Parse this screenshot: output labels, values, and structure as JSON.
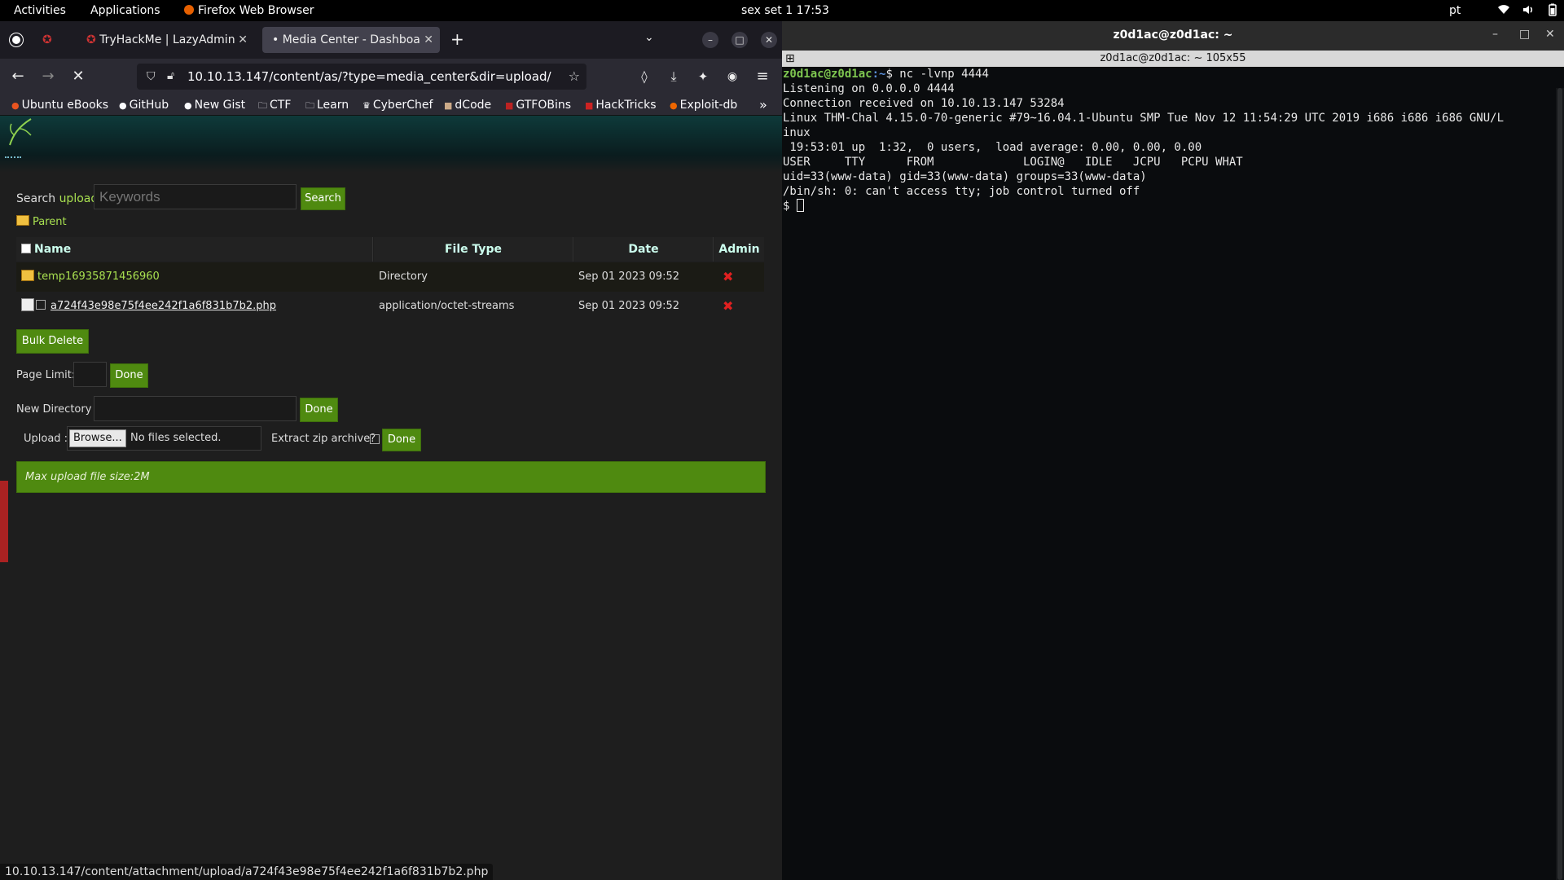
{
  "topbar": {
    "activities": "Activities",
    "applications": "Applications",
    "app_name": "Firefox Web Browser",
    "clock": "sex set 1  17:53",
    "lang": "pt"
  },
  "firefox": {
    "tabs": [
      {
        "label": "TryHackMe | LazyAdmin"
      },
      {
        "label": "Media Center - Dashboard"
      }
    ],
    "new_tab": "+",
    "url": "10.10.13.147/content/as/?type=media_center&dir=upload/",
    "bookmarks": [
      {
        "label": "Ubuntu eBooks"
      },
      {
        "label": "GitHub"
      },
      {
        "label": "New Gist"
      },
      {
        "label": "CTF"
      },
      {
        "label": "Learn"
      },
      {
        "label": "CyberChef"
      },
      {
        "label": "dCode"
      },
      {
        "label": "GTFOBins"
      },
      {
        "label": "HackTricks"
      },
      {
        "label": "Exploit-db"
      }
    ],
    "status_url": "10.10.13.147/content/attachment/upload/a724f43e98e75f4ee242f1a6f831b7b2.php"
  },
  "page": {
    "search_label_prefix": "Search ",
    "search_dir": "upload/",
    "search_placeholder": "Keywords",
    "search_button": "Search",
    "parent_link": "Parent",
    "columns": [
      "Name",
      "File Type",
      "Date",
      "Admin"
    ],
    "rows": [
      {
        "name": "temp16935871456960",
        "type": "Directory",
        "date": "Sep 01 2023 09:52"
      },
      {
        "name": "a724f43e98e75f4ee242f1a6f831b7b2.php",
        "type": "application/octet-streams",
        "date": "Sep 01 2023 09:52"
      }
    ],
    "bulk_delete": "Bulk Delete",
    "page_limit_label": "Page Limit:",
    "done": "Done",
    "new_directory_label": "New Directory :",
    "upload_label": "Upload :",
    "browse": "Browse...",
    "no_files": "No files selected.",
    "extract_label": "Extract zip archive?",
    "max_upload": "Max upload file size:2M"
  },
  "terminal": {
    "title": "z0d1ac@z0d1ac: ~",
    "subtitle": "z0d1ac@z0d1ac: ~ 105x55",
    "prompt_user": "z0d1ac@z0d1ac",
    "prompt_path": ":~",
    "command": "$ nc -lvnp 4444",
    "lines": [
      "Listening on 0.0.0.0 4444",
      "Connection received on 10.10.13.147 53284",
      "Linux THM-Chal 4.15.0-70-generic #79~16.04.1-Ubuntu SMP Tue Nov 12 11:54:29 UTC 2019 i686 i686 i686 GNU/L",
      "inux",
      " 19:53:01 up  1:32,  0 users,  load average: 0.00, 0.00, 0.00",
      "USER     TTY      FROM             LOGIN@   IDLE   JCPU   PCPU WHAT",
      "uid=33(www-data) gid=33(www-data) groups=33(www-data)",
      "/bin/sh: 0: can't access tty; job control turned off"
    ],
    "shell_prompt": "$ "
  }
}
